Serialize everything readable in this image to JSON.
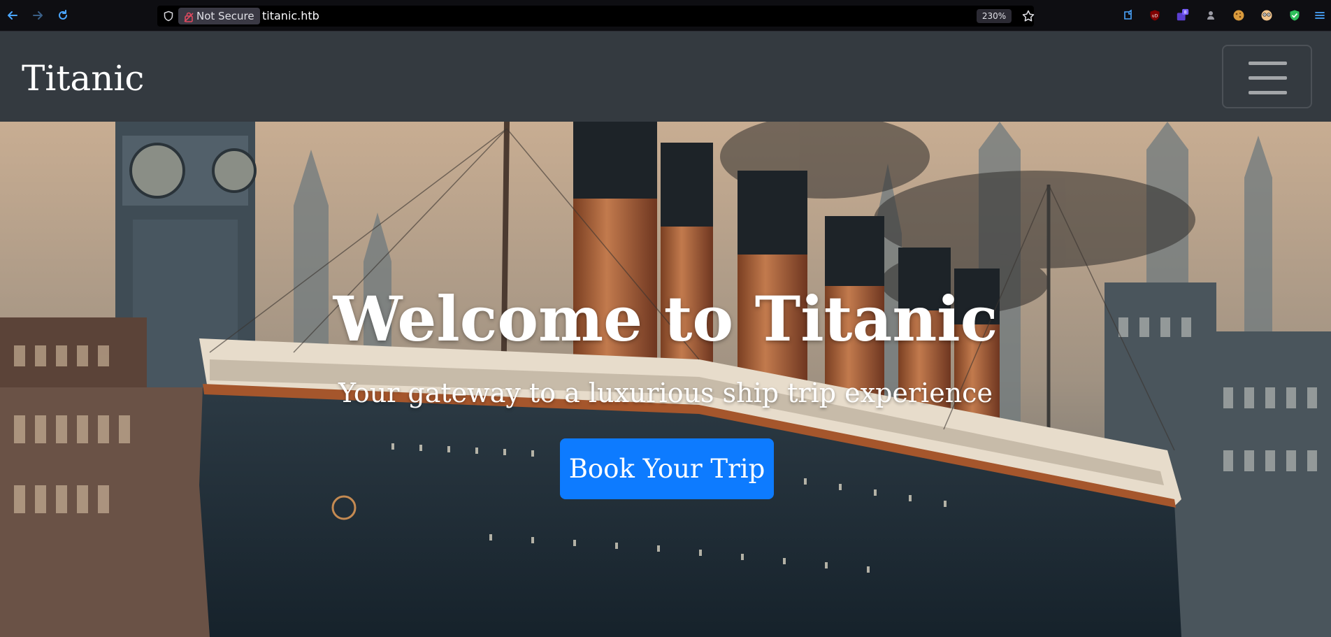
{
  "browser": {
    "security_label": "Not Secure",
    "url": "titanic.htb",
    "zoom": "230%",
    "extension_badge": "8",
    "icons": [
      "back-icon",
      "forward-icon",
      "reload-icon",
      "shield-icon",
      "lock-icon",
      "bookmark-star-icon",
      "extensions-icon",
      "ublock-icon",
      "extension-icon",
      "puzzle-icon",
      "cookie-icon",
      "owl-icon",
      "shield-check-icon",
      "menu-icon"
    ]
  },
  "navbar": {
    "brand": "Titanic",
    "toggler_icon": "hamburger-icon"
  },
  "hero": {
    "title": "Welcome to Titanic",
    "subtitle": "Your gateway to a luxurious ship trip experience",
    "cta_label": "Book Your Trip"
  },
  "colors": {
    "navbar_bg": "#343a40",
    "cta_bg": "#0d7bff",
    "browser_bg": "#0e0e12"
  }
}
